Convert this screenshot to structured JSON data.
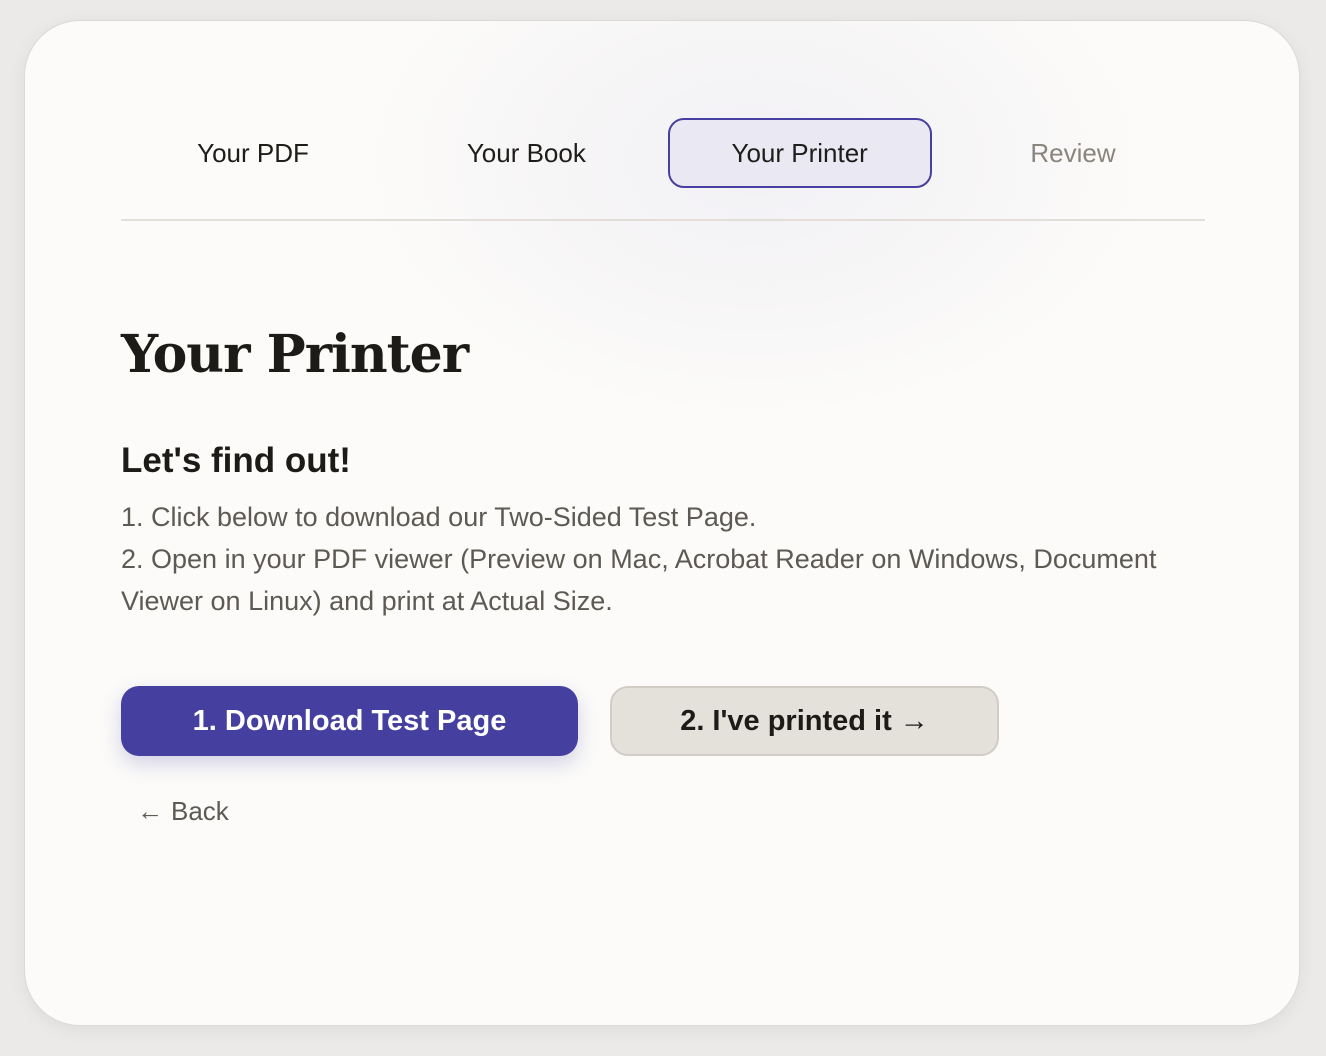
{
  "stepper": {
    "steps": [
      {
        "label": "Your PDF",
        "state": "done"
      },
      {
        "label": "Your Book",
        "state": "done"
      },
      {
        "label": "Your Printer",
        "state": "active"
      },
      {
        "label": "Review",
        "state": "upcoming"
      }
    ]
  },
  "main": {
    "title": "Your Printer",
    "subheading": "Let's find out!",
    "instructions": [
      "1. Click below to download our Two-Sided Test Page.",
      "2. Open in your PDF viewer (Preview on Mac, Acrobat Reader on Windows, Document Viewer on Linux) and print at Actual Size."
    ]
  },
  "actions": {
    "download_label": "1. Download Test Page",
    "printed_label": "2. I've printed it →",
    "back_arrow": "←",
    "back_label": "Back"
  },
  "colors": {
    "accent": "#4540a0",
    "active_step_bg": "#e9e8f3",
    "secondary_button_bg": "#e4e0da",
    "card_bg": "#fcfbf9"
  }
}
